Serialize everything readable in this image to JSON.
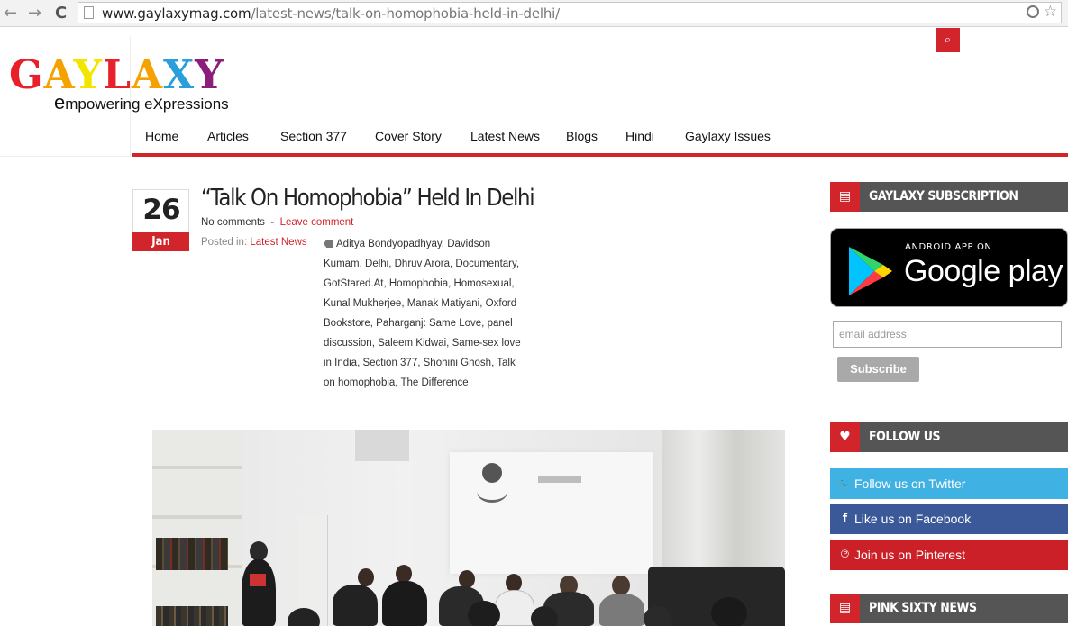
{
  "browser": {
    "back_glyph": "←",
    "forward_glyph": "→",
    "reload_glyph": "C",
    "url_domain": "www.gaylaxymag.com",
    "url_path": "/latest-news/talk-on-homophobia-held-in-delhi/",
    "bookmark_glyph": "☆"
  },
  "site": {
    "logo_letters": [
      {
        "char": "G",
        "color": "#e8202a"
      },
      {
        "char": "A",
        "color": "#f5a100"
      },
      {
        "char": "Y",
        "color": "#f2e600"
      },
      {
        "char": "L",
        "color": "#e8202a"
      },
      {
        "char": "A",
        "color": "#f5a100"
      },
      {
        "char": "X",
        "color": "#29a0dc"
      },
      {
        "char": "Y",
        "color": "#8b1e7a"
      }
    ],
    "tagline": "empowering eXpressions",
    "search_glyph": "⌕",
    "accent": "#d1242b"
  },
  "nav": {
    "items": [
      "Home",
      "Articles",
      "Section 377",
      "Cover Story",
      "Latest News",
      "Blogs",
      "Hindi",
      "Gaylaxy Issues"
    ]
  },
  "post": {
    "day": "26",
    "month": "Jan",
    "title": "“Talk On Homophobia” Held In Delhi",
    "comments": "No comments",
    "separator": "-",
    "leave_comment": "Leave comment",
    "posted_in_label": "Posted in:",
    "category": "Latest News",
    "tags": [
      "Aditya Bondyopadhyay",
      "Davidson Kumam",
      "Delhi",
      "Dhruv Arora",
      "Documentary",
      "GotStared.At",
      "Homophobia",
      "Homosexual",
      "Kunal Mukherjee",
      "Manak Matiyani",
      "Oxford Bookstore",
      "Paharganj: Same Love",
      "panel discussion",
      "Saleem Kidwai",
      "Same-sex love in India",
      "Section 377",
      "Shohini Ghosh",
      "Talk on homophobia",
      "The Difference"
    ]
  },
  "sidebar": {
    "subscription_title": "GAYLAXY SUBSCRIPTION",
    "subscription_glyph": "▤",
    "gplay_small": "ANDROID APP ON",
    "gplay_big": "Google play",
    "email_placeholder": "email address",
    "subscribe_label": "Subscribe",
    "follow_title": "FOLLOW US",
    "follow_glyph": "♥",
    "social": [
      {
        "label": "Follow us on Twitter",
        "glyph": "🐦",
        "color": "#3fb1e3"
      },
      {
        "label": "Like us on Facebook",
        "glyph": "f",
        "color": "#3b5998"
      },
      {
        "label": "Join us on Pinterest",
        "glyph": "℗",
        "color": "#cb2027"
      }
    ],
    "pink_title": "PINK SIXTY NEWS",
    "pink_glyph": "▤"
  }
}
